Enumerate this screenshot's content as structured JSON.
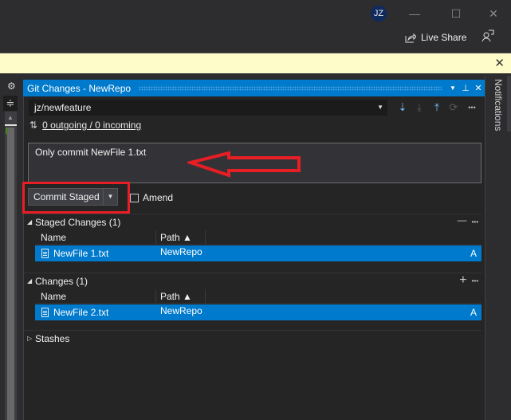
{
  "titlebar": {
    "avatar_initials": "JZ",
    "minimize": "—",
    "maximize": "☐",
    "close": "✕",
    "live_share_label": "Live Share",
    "live_share_icon": "share-icon",
    "feedback_icon": "feedback-icon"
  },
  "infobar": {
    "close": "✕"
  },
  "leftstrip": {
    "gear": "⚙",
    "split": "≑"
  },
  "panel": {
    "title": "Git Changes - NewRepo",
    "title_buttons": {
      "dropdown": "▼",
      "pin": "⊥",
      "close": "✕"
    },
    "branch": "jz/newfeature",
    "branch_dropdown": "▼",
    "toolbar": {
      "fetch": "⇣",
      "pull": "⤓",
      "push": "⤒",
      "sync": "⟳",
      "more": "•••"
    },
    "sync_icon": "⇅",
    "sync_text": "0 outgoing / 0 incoming",
    "commit_message": "Only commit NewFile 1.txt",
    "commit_button": "Commit Staged",
    "commit_dropdown": "▼",
    "amend_label": "Amend",
    "staged": {
      "header": "Staged Changes (1)",
      "toggle": "◢",
      "actions": {
        "unstage": "—",
        "more": "•••"
      },
      "columns": [
        "Name",
        "Path ▲"
      ],
      "rows": [
        {
          "name": "NewFile 1.txt",
          "path": "NewRepo",
          "status": "A"
        }
      ]
    },
    "changes": {
      "header": "Changes (1)",
      "toggle": "◢",
      "actions": {
        "stage": "+",
        "more": "•••"
      },
      "columns": [
        "Name",
        "Path ▲"
      ],
      "rows": [
        {
          "name": "NewFile 2.txt",
          "path": "NewRepo",
          "status": "A"
        }
      ]
    },
    "stashes": {
      "header": "Stashes",
      "toggle": "▷"
    }
  },
  "notifications": {
    "label": "Notifications"
  },
  "annotation_colors": {
    "highlight": "#e81e25",
    "accent": "#007acc"
  }
}
